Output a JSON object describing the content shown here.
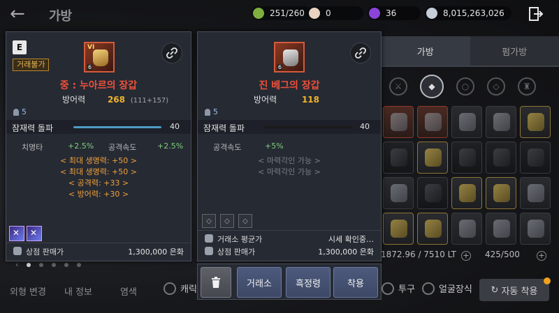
{
  "topbar": {
    "title": "가방",
    "resources": [
      {
        "name": "energy",
        "value": "251/260",
        "color": "#7fae3f"
      },
      {
        "name": "pearl",
        "value": "0",
        "color": "#e9d3c3"
      },
      {
        "name": "gem",
        "value": "36",
        "color": "#8a44d9"
      },
      {
        "name": "silver",
        "value": "8,015,263,026",
        "color": "#c4cdd8"
      }
    ]
  },
  "inventory": {
    "tabs": [
      "가방",
      "펌가방"
    ],
    "weight": "1872.96 / 7510 LT",
    "slots": "425/500"
  },
  "bottom": {
    "buttons": [
      "외형 변경",
      "내 정보",
      "염색"
    ],
    "checks": [
      "캐릭",
      "투구",
      "얼굴장식"
    ],
    "auto": "자동 착용"
  },
  "item1": {
    "grade": "E",
    "trade_tag": "거래불가",
    "tier": "VI",
    "icon_level": "6",
    "name": "중 : 누아르의 장갑",
    "stat_label": "방어력",
    "stat_value": "268",
    "stat_sub": "(111+157)",
    "level": "5",
    "potential_label": "잠재력 돌파",
    "potential_value": "40",
    "potential_fraction": 1.0,
    "sub_stats": [
      {
        "k": "치명타",
        "v": "+2.5%"
      },
      {
        "k": "공격속도",
        "v": "+2.5%"
      }
    ],
    "options": [
      "< 최대 생명력: +50 >",
      "< 최대 생명력: +50 >",
      "< 공격력: +33 >",
      "< 방어력: +30 >"
    ],
    "shop_label": "상점 판매가",
    "shop_price": "1,300,000 은화"
  },
  "item2": {
    "icon_level": "6",
    "name": "진 베그의 장갑",
    "stat_label": "방어력",
    "stat_value": "118",
    "level": "5",
    "potential_label": "잠재력 돌파",
    "potential_value": "40",
    "potential_fraction": 0.0,
    "sub_stat": {
      "k": "공격속도",
      "v": "+5%"
    },
    "options": [
      "< 마력각인 가능 >",
      "< 마력각인 가능 >"
    ],
    "market_label": "거래소 평균가",
    "market_value": "시세 확인중…",
    "shop_label": "상점 판매가",
    "shop_price": "1,300,000 은화"
  },
  "actions": {
    "trade": "거래소",
    "refine": "흑정령",
    "equip": "착용"
  }
}
